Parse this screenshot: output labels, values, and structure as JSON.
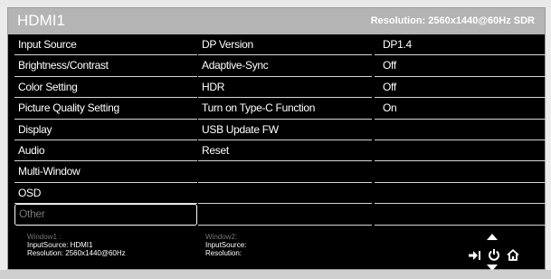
{
  "header": {
    "input_name": "HDMI1",
    "resolution": "Resolution: 2560x1440@60Hz SDR"
  },
  "main_menu": [
    {
      "label": "Input Source"
    },
    {
      "label": "Brightness/Contrast"
    },
    {
      "label": "Color Setting"
    },
    {
      "label": "Picture Quality Setting"
    },
    {
      "label": "Display"
    },
    {
      "label": "Audio"
    },
    {
      "label": "Multi-Window"
    },
    {
      "label": "OSD"
    },
    {
      "label": "Other",
      "selected": true
    }
  ],
  "sub_menu": [
    {
      "label": "DP Version"
    },
    {
      "label": "Adaptive-Sync"
    },
    {
      "label": "HDR"
    },
    {
      "label": "Turn on Type-C Function"
    },
    {
      "label": "USB Update FW"
    },
    {
      "label": "Reset"
    },
    {
      "label": ""
    },
    {
      "label": ""
    },
    {
      "label": ""
    }
  ],
  "values": [
    {
      "label": "DP1.4"
    },
    {
      "label": "Off"
    },
    {
      "label": "Off"
    },
    {
      "label": "On"
    },
    {
      "label": ""
    },
    {
      "label": ""
    },
    {
      "label": ""
    },
    {
      "label": ""
    },
    {
      "label": ""
    }
  ],
  "window1": {
    "title": "Window1 :",
    "input": "InputSource: HDMI1",
    "resolution": "Resolution: 2560x1440@60Hz"
  },
  "window2": {
    "title": "Window2:",
    "input": "InputSource:",
    "resolution": "Resolution:"
  },
  "nav_icons": [
    "up-arrow-icon",
    "enter-icon",
    "power-icon",
    "home-icon",
    "down-arrow-icon"
  ],
  "colors": {
    "background": "#000000",
    "header": "#b4b4b4",
    "divider": "#d6d6d6",
    "dim_text": "#777777"
  }
}
